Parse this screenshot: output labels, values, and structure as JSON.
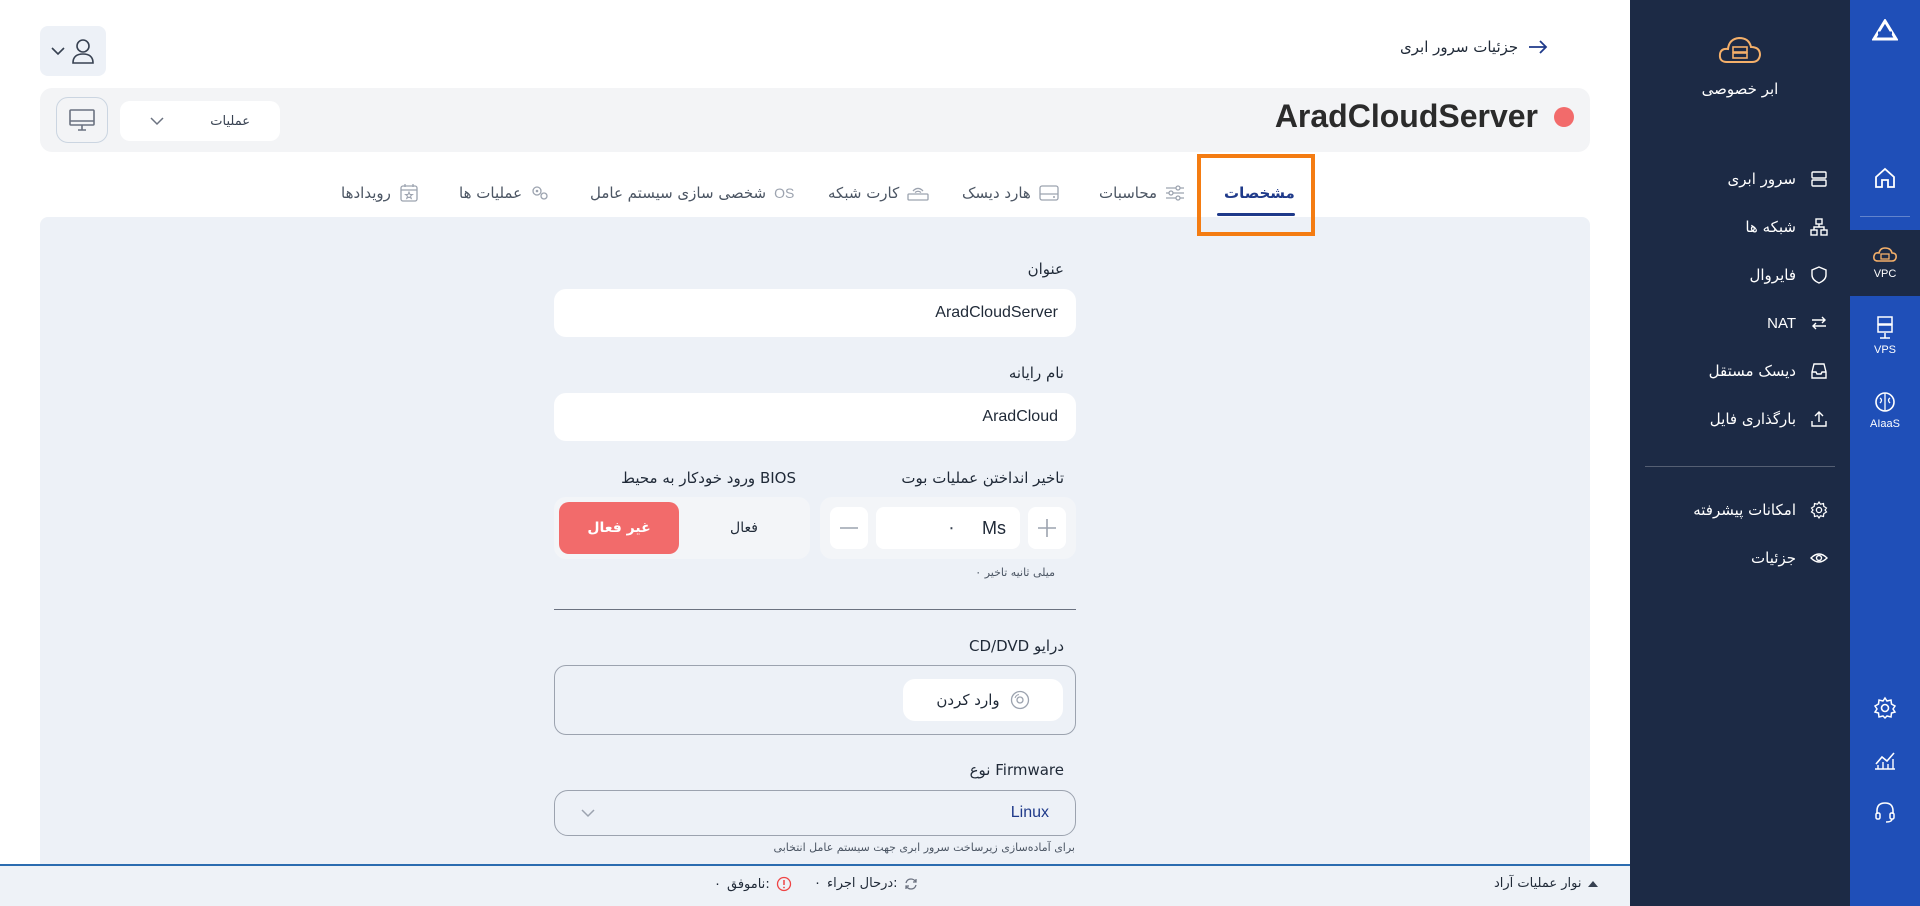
{
  "rail": {
    "items": [
      {
        "label": "",
        "icon": "home-icon"
      },
      {
        "label": "VPC",
        "icon": "cloud-server-icon"
      },
      {
        "label": "VPS",
        "icon": "server-rack-icon"
      },
      {
        "label": "AIaaS",
        "icon": "brain-icon"
      }
    ],
    "bottom": [
      {
        "icon": "gear-icon"
      },
      {
        "icon": "chart-icon"
      },
      {
        "icon": "headset-icon"
      }
    ]
  },
  "sidebar": {
    "brand_name": "ابر خصوصی",
    "items": [
      {
        "label": "سرور ابری",
        "icon": "server-icon"
      },
      {
        "label": "شبکه ها",
        "icon": "network-icon"
      },
      {
        "label": "فایروال",
        "icon": "shield-icon"
      },
      {
        "label": "NAT",
        "icon": "arrows-icon"
      },
      {
        "label": "دیسک مستقل",
        "icon": "disk-icon"
      },
      {
        "label": "بارگذاری فایل",
        "icon": "upload-icon"
      }
    ],
    "advanced": [
      {
        "label": "امکانات پیشرفته",
        "icon": "gear-icon"
      },
      {
        "label": "جزئیات",
        "icon": "eye-icon"
      }
    ]
  },
  "header": {
    "back_label": "جزئیات سرور ابری"
  },
  "server": {
    "name": "AradCloudServer",
    "status_color": "#f26b6b",
    "ops_label": "عملیات"
  },
  "tabs": [
    {
      "label": "مشخصات",
      "active": true
    },
    {
      "label": "محاسبات"
    },
    {
      "label": "هارد دیسک"
    },
    {
      "label": "کارت شبکه"
    },
    {
      "label": "شخصی سازی سیستم عامل",
      "prefix": "OS"
    },
    {
      "label": "عملیات ها"
    },
    {
      "label": "رویدادها"
    }
  ],
  "form": {
    "title_label": "عنوان",
    "title_value": "AradCloudServer",
    "hostname_label": "نام رایانه",
    "hostname_value": "AradCloud",
    "boot_delay_label": "تاخیر انداختن عملیات بوت",
    "boot_delay_unit": "Ms",
    "boot_delay_value": "۰",
    "boot_delay_hint": "۰ میلی ثانیه تاخیر",
    "bios_label": "ورود خودکار به محیط BIOS",
    "bios_on": "فعال",
    "bios_off": "غیر فعال",
    "cd_label": "CD/DVD درایو",
    "mount_label": "وارد کردن",
    "firmware_label": "نوع Firmware",
    "firmware_value": "Linux",
    "firmware_hint": "برای آماده‌سازی زیرساخت سرور ابری جهت سیستم عامل انتخابی"
  },
  "statusbar": {
    "title": "نوار عملیات آراد",
    "running_label": "درحال اجراء:",
    "running_count": "۰",
    "failed_label": "ناموفق:",
    "failed_count": "۰"
  },
  "colors": {
    "rail": "#1f4fb8",
    "sidebar": "#1c2a45",
    "accent": "#1f3a8a",
    "danger": "#f26b6b",
    "highlight": "#f47c12"
  }
}
